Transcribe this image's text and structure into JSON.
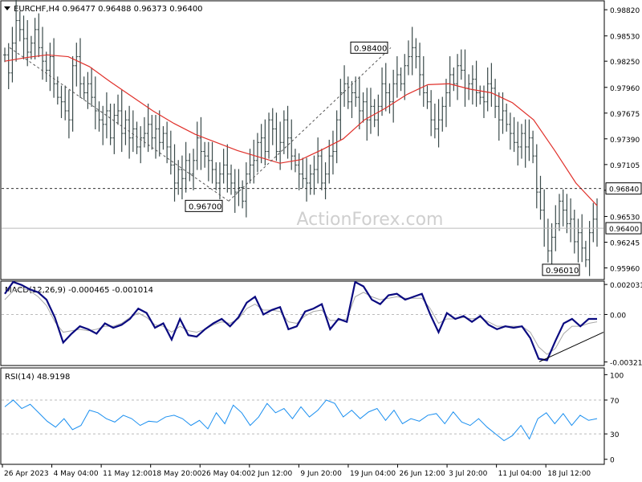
{
  "header": {
    "symbol": "EURCHF,H4",
    "ohlc": "0.96477 0.96488 0.96373 0.96400",
    "macd_label": "MACD(12,26,9) -0.000465 -0.001014",
    "rsi_label": "RSI(14) 48.9198"
  },
  "watermark": "ActionForex.com",
  "colors": {
    "price_bars": "#3a4a4a",
    "moving_average": "#e0302a",
    "macd_line": "#0a0a80",
    "signal_line": "#a8a8a8",
    "rsi_line": "#1a8ff0",
    "trendline": "#000000",
    "background": "#ffffff"
  },
  "chart_data": [
    {
      "type": "ohlc",
      "pane": "price",
      "title": "EURCHF,H4",
      "ylim": [
        0.9584,
        0.9891
      ],
      "y_ticks": [
        "0.98820",
        "0.98530",
        "0.98250",
        "0.97960",
        "0.97675",
        "0.97390",
        "0.97105",
        "0.96820",
        "0.96530",
        "0.96245",
        "0.95960"
      ],
      "x_ticks": [
        "26 Apr 2023",
        "4 May 04:00",
        "11 May 12:00",
        "18 May 20:00",
        "26 May 04:00",
        "2 Jun 12:00",
        "9 Jun 20:00",
        "19 Jun 04:00",
        "26 Jun 12:00",
        "3 Jul 20:00",
        "11 Jul 04:00",
        "18 Jul 12:00"
      ],
      "close_series": [
        [
          0.9832,
          0.9812,
          0.9845,
          0.987,
          0.986,
          0.985,
          0.9835,
          0.9845,
          0.986,
          0.984,
          0.9825,
          0.9815,
          0.983,
          0.98,
          0.9785,
          0.978,
          0.977,
          0.976,
          0.982,
          0.983,
          0.98,
          0.979,
          0.98,
          0.9785,
          0.977,
          0.976,
          0.9755,
          0.977,
          0.974,
          0.9765,
          0.977,
          0.9745,
          0.976,
          0.974,
          0.975,
          0.973,
          0.974,
          0.9745,
          0.9755,
          0.974,
          0.975,
          0.9735,
          0.9745,
          0.973,
          0.971,
          0.969,
          0.9705,
          0.9695,
          0.9715,
          0.97,
          0.9715,
          0.974,
          0.9725,
          0.972,
          0.9715,
          0.9705,
          0.969,
          0.97,
          0.971,
          0.97,
          0.969,
          0.968,
          0.9685,
          0.967,
          0.97,
          0.971,
          0.9715,
          0.9735,
          0.974,
          0.9725,
          0.976,
          0.975,
          0.9725,
          0.9735,
          0.976,
          0.974,
          0.972,
          0.971,
          0.97,
          0.9695,
          0.969,
          0.97,
          0.9705,
          0.972,
          0.969,
          0.97,
          0.972,
          0.9725,
          0.976,
          0.979,
          0.98,
          0.978,
          0.979,
          0.9785,
          0.977,
          0.978,
          0.976,
          0.9775,
          0.976,
          0.9775,
          0.98,
          0.979,
          0.978,
          0.98,
          0.981,
          0.98,
          0.982,
          0.983,
          0.984,
          0.983,
          0.981,
          0.979,
          0.978,
          0.976,
          0.975,
          0.976,
          0.9775,
          0.979,
          0.981,
          0.98,
          0.982,
          0.9815,
          0.9795,
          0.98,
          0.9805,
          0.979,
          0.9785,
          0.978,
          0.98,
          0.9795,
          0.9775,
          0.976,
          0.977,
          0.9755,
          0.9745,
          0.9735,
          0.973,
          0.9745,
          0.973,
          0.974,
          0.972,
          0.968,
          0.966,
          0.964,
          0.9615,
          0.963,
          0.9645,
          0.967,
          0.966,
          0.9645,
          0.965,
          0.9625,
          0.9635,
          0.9618,
          0.9605,
          0.9635,
          0.965,
          0.964
        ]
      ],
      "moving_average": [
        0.9825,
        0.9829,
        0.9832,
        0.983,
        0.9819,
        0.9802,
        0.9786,
        0.977,
        0.9756,
        0.9744,
        0.9735,
        0.9726,
        0.9719,
        0.9712,
        0.9716,
        0.9727,
        0.9739,
        0.976,
        0.9773,
        0.9788,
        0.9799,
        0.98,
        0.9794,
        0.979,
        0.9779,
        0.976,
        0.9726,
        0.969,
        0.9665
      ],
      "price_labels": [
        {
          "text": "0.98400",
          "value": 0.984
        },
        {
          "text": "0.96700",
          "value": 0.967
        },
        {
          "text": "0.96010",
          "value": 0.9601
        }
      ],
      "current_price": {
        "text": "0.96400",
        "value": 0.964
      },
      "horizontal_level": {
        "text": "0.96840",
        "value": 0.9684
      }
    },
    {
      "type": "line",
      "pane": "macd",
      "title": "MACD(12,26,9) -0.000465 -0.001014",
      "ylim": [
        -0.0034,
        0.0022
      ],
      "y_ticks": [
        "0.002031",
        "0.00",
        "-0.003214"
      ],
      "macd": [
        0.0014,
        0.0022,
        0.002,
        0.0017,
        0.0015,
        0.001,
        -0.0002,
        -0.0019,
        -0.0013,
        -0.0008,
        -0.001,
        -0.0013,
        -0.0006,
        -0.0009,
        -0.0007,
        -0.0003,
        0.0004,
        0.0001,
        -0.0009,
        -0.0006,
        -0.0017,
        -0.0003,
        -0.0014,
        -0.0015,
        -0.001,
        -0.0006,
        -0.0003,
        -0.0008,
        -0.0002,
        0.0008,
        0.0012,
        0.0,
        0.0003,
        0.0005,
        -0.001,
        -0.0008,
        0.0002,
        0.0004,
        0.0007,
        -0.001,
        -0.0003,
        -0.0005,
        0.0022,
        0.0019,
        0.001,
        0.0007,
        0.0013,
        0.0014,
        0.001,
        0.0012,
        0.0014,
        0.0,
        -0.0012,
        0.0001,
        -0.0003,
        -0.0001,
        -0.0005,
        -0.0001,
        -0.0007,
        -0.001,
        -0.0008,
        -0.0009,
        -0.0008,
        -0.0016,
        -0.003,
        -0.0031,
        -0.0018,
        -0.0006,
        -0.0003,
        -0.0008,
        -0.0003,
        -0.0003
      ],
      "signal": [
        0.001,
        0.0016,
        0.0018,
        0.0016,
        0.0012,
        0.0006,
        -0.0005,
        -0.0012,
        -0.0011,
        -0.001,
        -0.0011,
        -0.001,
        -0.0008,
        -0.0008,
        -0.0006,
        -0.0002,
        0.0001,
        -0.0002,
        -0.0007,
        -0.0008,
        -0.0012,
        -0.0008,
        -0.0011,
        -0.0012,
        -0.001,
        -0.0007,
        -0.0005,
        -0.0006,
        -0.0003,
        0.0004,
        0.0007,
        0.0003,
        0.0003,
        0.0002,
        -0.0005,
        -0.0006,
        -0.0001,
        0.0002,
        0.0003,
        -0.0004,
        -0.0004,
        -0.0003,
        0.0012,
        0.0015,
        0.0012,
        0.001,
        0.0011,
        0.0012,
        0.0011,
        0.0011,
        0.0011,
        0.0004,
        -0.0006,
        -0.0003,
        -0.0003,
        -0.0002,
        -0.0003,
        -0.0002,
        -0.0005,
        -0.0008,
        -0.0008,
        -0.0008,
        -0.0008,
        -0.0012,
        -0.0022,
        -0.0027,
        -0.0023,
        -0.0013,
        -0.0008,
        -0.0008,
        -0.0006,
        -0.0005
      ],
      "trendline": [
        [
          -0.0032,
          0.0
        ],
        [
          -0.0017,
          1.0
        ]
      ]
    },
    {
      "type": "line",
      "pane": "rsi",
      "title": "RSI(14) 48.9198",
      "ylim": [
        -5,
        107
      ],
      "y_ticks": [
        "100",
        "70",
        "30",
        "0"
      ],
      "levels": [
        70,
        30
      ],
      "values": [
        62,
        70,
        60,
        65,
        55,
        45,
        38,
        48,
        35,
        40,
        58,
        55,
        48,
        44,
        52,
        48,
        40,
        45,
        44,
        50,
        52,
        48,
        40,
        46,
        36,
        55,
        42,
        64,
        55,
        40,
        50,
        66,
        55,
        60,
        48,
        62,
        50,
        58,
        70,
        66,
        50,
        58,
        48,
        56,
        60,
        46,
        58,
        42,
        48,
        45,
        52,
        54,
        42,
        56,
        44,
        40,
        48,
        38,
        30,
        22,
        28,
        40,
        24,
        48,
        55,
        42,
        54,
        40,
        52,
        46,
        48
      ]
    }
  ]
}
